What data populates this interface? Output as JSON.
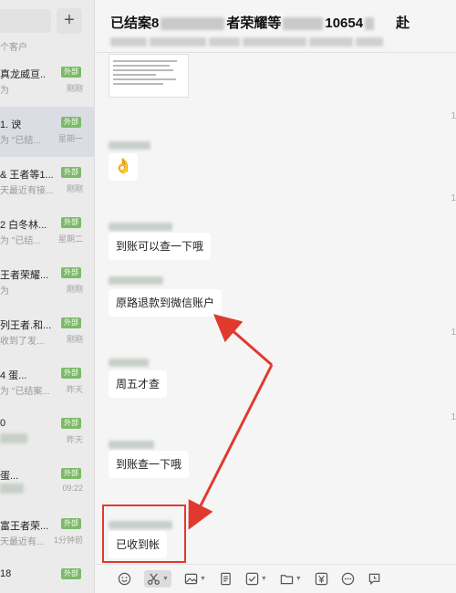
{
  "sidebar": {
    "add_label": "+",
    "section_label": "个客户",
    "conversations": [
      {
        "name": "真龙威亘..",
        "tag": "外部",
        "preview": "为",
        "time": "刚刚"
      },
      {
        "name": "1. 谀",
        "tag": "外部",
        "preview": "为 \"已结...",
        "time": "星期一"
      },
      {
        "name": "& 王者等1...",
        "tag": "外部",
        "preview": "天最近有接...",
        "time": "刚刚"
      },
      {
        "name": "2 白冬林...",
        "tag": "外部",
        "preview": "为 \"已结...",
        "time": "星期二"
      },
      {
        "name": "王者荣耀...",
        "tag": "外部",
        "preview": "为",
        "time": "刚刚"
      },
      {
        "name": "列王者.和...",
        "tag": "外部",
        "preview": "收到了发...",
        "time": "刚刚"
      },
      {
        "name": "4 蛋...",
        "tag": "外部",
        "preview": "为 \"已结案...",
        "time": "昨天"
      },
      {
        "name": "0",
        "tag": "外部",
        "preview": "",
        "time": "昨天"
      },
      {
        "name": "蛋...",
        "tag": "外部",
        "preview": "",
        "time": "09:22"
      },
      {
        "name": "富王者荣...",
        "tag": "外部",
        "preview": "天最近有...",
        "time": "1分钟前"
      },
      {
        "name": "18",
        "tag": "外部",
        "preview": "",
        "time": ""
      }
    ]
  },
  "header": {
    "title_start": "已结案8",
    "title_mid": "者荣耀等",
    "title_end": "10654",
    "title_tail": "赴"
  },
  "messages": {
    "stamp": "1",
    "items": [
      {
        "text": "👌",
        "kind": "emoji"
      },
      {
        "text": "到账可以查一下哦",
        "kind": "text"
      },
      {
        "text": "原路退款到微信账户",
        "kind": "text"
      },
      {
        "text": "周五才查",
        "kind": "text"
      },
      {
        "text": "到账查一下哦",
        "kind": "text"
      },
      {
        "text": "已收到帐",
        "kind": "text"
      }
    ]
  },
  "toolbar": {
    "icons": [
      "emoji-icon",
      "scissors-icon",
      "image-icon",
      "document-icon",
      "checkbox-icon",
      "folder-icon",
      "payment-icon",
      "more-icon",
      "history-icon"
    ]
  },
  "colors": {
    "sidebar_bg": "#ebebeb",
    "active_bg": "#dadde3",
    "tag_green": "#7cba67",
    "annotation_red": "#e03a2f"
  }
}
